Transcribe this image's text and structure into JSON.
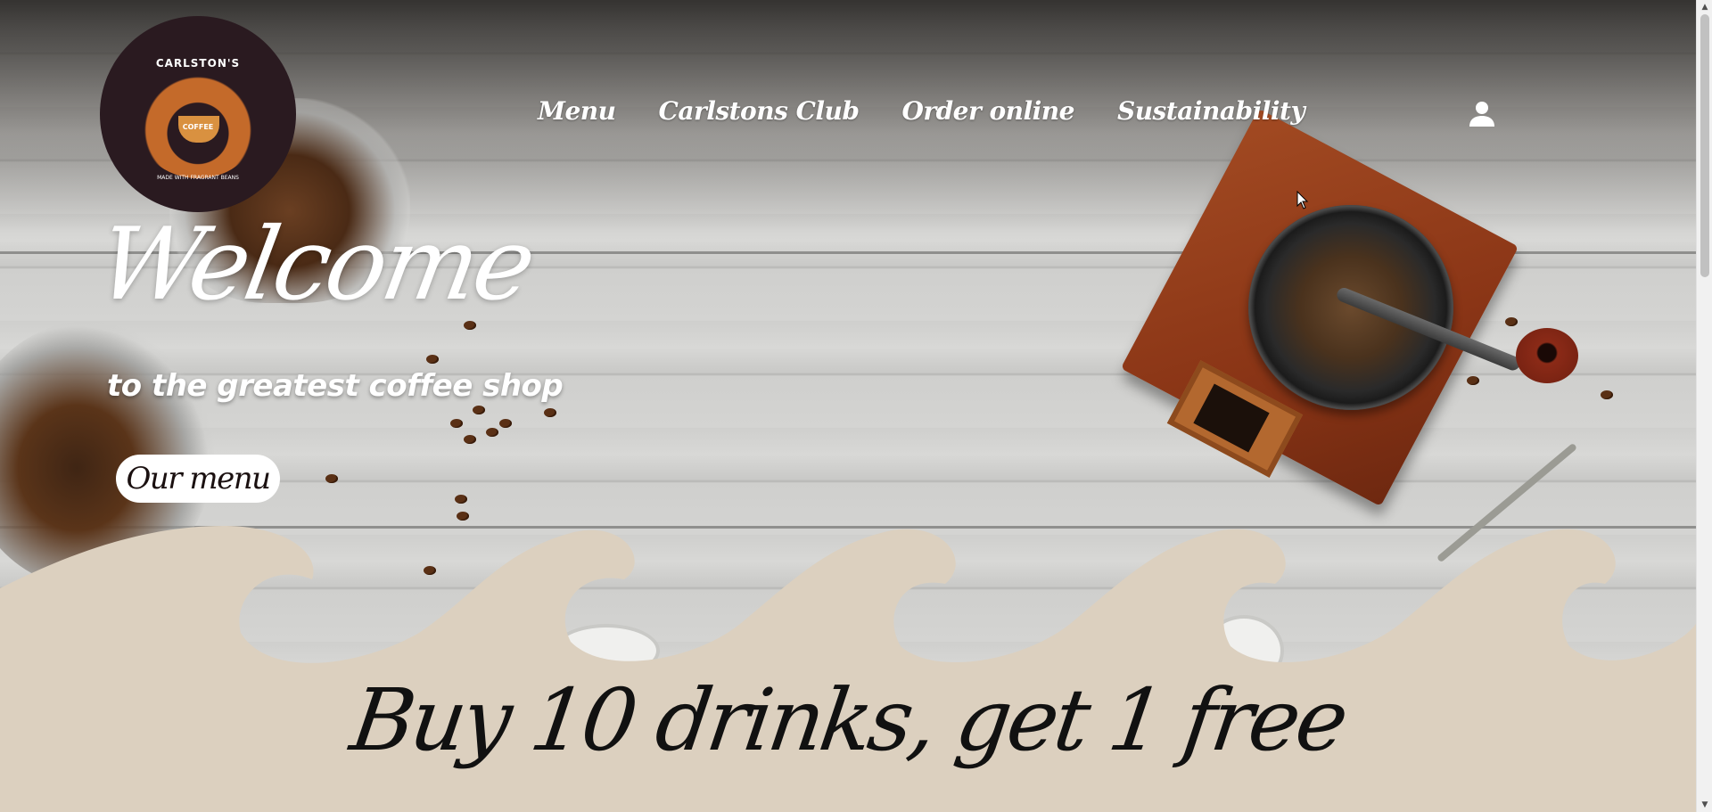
{
  "brand": {
    "name": "CARLSTON'S",
    "badge": "COFFEE",
    "tagline": "MADE WITH FRAGRANT BEANS",
    "logo_bg": "#2a1a20",
    "accent": "#c46a2a"
  },
  "nav": {
    "items": [
      {
        "label": "Menu"
      },
      {
        "label": "Carlstons Club"
      },
      {
        "label": "Order online"
      },
      {
        "label": "Sustainability"
      }
    ],
    "account_icon": "user-icon"
  },
  "hero": {
    "title": "Welcome",
    "subtitle": "to the greatest coffee shop",
    "cta_label": "Our menu"
  },
  "promo": {
    "text": "Buy 10 drinks, get 1 free",
    "band_color": "#dcd0bf"
  },
  "scrollbar": {
    "up_arrow": "▲",
    "down_arrow": "▼"
  }
}
